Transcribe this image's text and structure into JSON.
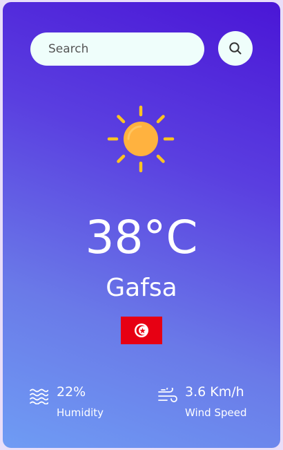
{
  "search": {
    "placeholder": "Search",
    "value": ""
  },
  "weather": {
    "icon": "sun-icon",
    "temperature": "38°C",
    "city": "Gafsa",
    "country_flag": "tunisia-flag"
  },
  "details": {
    "humidity": {
      "value": "22%",
      "label": "Humidity",
      "icon": "humidity-waves-icon"
    },
    "wind": {
      "value": "3.6 Km/h",
      "label": "Wind Speed",
      "icon": "wind-icon"
    }
  },
  "colors": {
    "gradient_top": "#4a16d6",
    "gradient_bottom": "#6f9cf4",
    "search_background": "#effefb",
    "sun": "#ffb23f",
    "sun_rays": "#ffc421",
    "flag_red": "#e70013"
  }
}
